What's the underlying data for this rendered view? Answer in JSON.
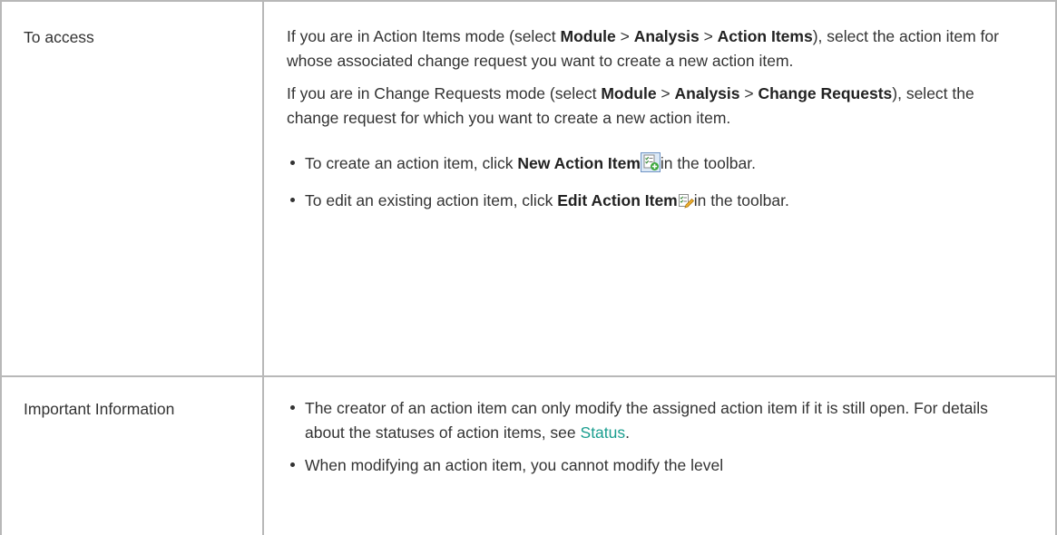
{
  "rows": [
    {
      "label": "To access",
      "paragraphs": [
        {
          "t1": "If you are in Action Items mode (select ",
          "b1": "Module",
          "t2": " > ",
          "b2": "Analysis",
          "t3": " > ",
          "b3": "Action Items",
          "t4": "), select the action item for whose associated change request you want to create a new action item."
        },
        {
          "t1": "If you are in Change Requests mode (select ",
          "b1": "Module",
          "t2": " > ",
          "b2": "Analysis",
          "t3": " > ",
          "b3": "Change Requests",
          "t4": "), select the change request for which you want to create a new action item."
        }
      ],
      "bullets": [
        {
          "pre": "To create an action item, click ",
          "bold": "New Action Item",
          "post": "in the toolbar.",
          "icon": "new-action-item-icon"
        },
        {
          "pre": "To edit an existing action item, click ",
          "bold": "Edit Action Item",
          "post": "in the toolbar.",
          "icon": "edit-action-item-icon"
        }
      ]
    },
    {
      "label": "Important Information",
      "bullets": [
        {
          "pre": "The creator of an action item can only modify the assigned action item if it is still open. For details about the statuses of action items, see ",
          "link": "Status",
          "post": "."
        },
        {
          "pre": "When modifying an action item, you cannot modify the level"
        }
      ]
    }
  ],
  "colors": {
    "border": "#b8b8b8",
    "text": "#333333",
    "link": "#1a9e8f"
  }
}
